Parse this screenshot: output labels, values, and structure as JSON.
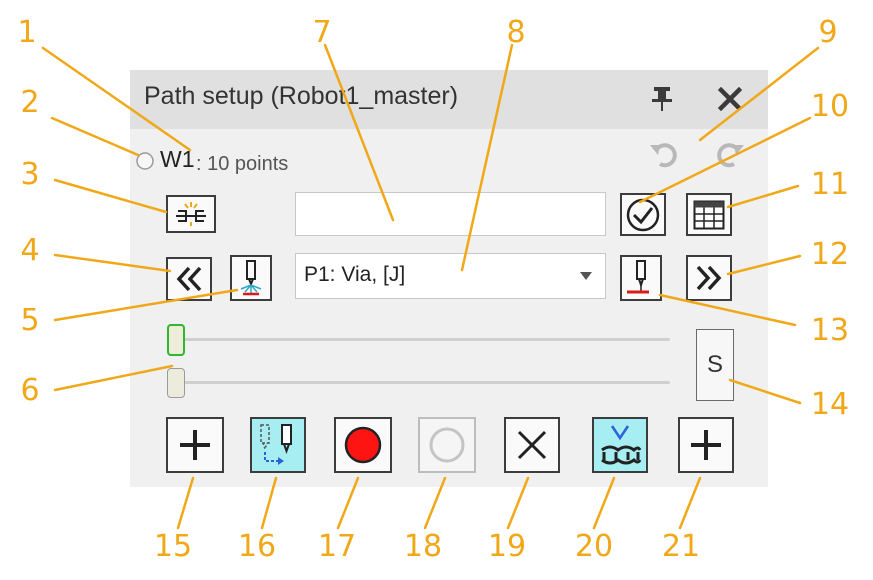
{
  "callouts": [
    "1",
    "2",
    "3",
    "4",
    "5",
    "6",
    "7",
    "8",
    "9",
    "10",
    "11",
    "12",
    "13",
    "14",
    "15",
    "16",
    "17",
    "18",
    "19",
    "20",
    "21"
  ],
  "window": {
    "title": "Path setup (Robot1_master)"
  },
  "waypoint": {
    "name": "W1",
    "count_text": ": 10 points"
  },
  "point_name_value": "",
  "point_select": {
    "selected": "P1: Via, [J]"
  },
  "speed_button_label": "S",
  "colors": {
    "callout": "#f0a818",
    "accent_cyan": "#a7eef2",
    "record_red": "#ff1414",
    "slider_green": "#2fb52f"
  },
  "icons": {
    "pin": "pin-icon",
    "close": "close-icon",
    "undo": "undo-icon",
    "redo": "redo-icon",
    "split": "split-icon",
    "check": "check-circle-icon",
    "table": "table-icon",
    "prev": "double-chevron-left-icon",
    "next": "double-chevron-right-icon",
    "tool_spray": "tool-spray-icon",
    "tool_down": "tool-down-icon",
    "add": "plus-icon",
    "move_tool": "move-tool-icon",
    "record": "record-icon",
    "circle": "circle-icon",
    "delete": "x-icon",
    "surface": "surface-points-icon"
  }
}
